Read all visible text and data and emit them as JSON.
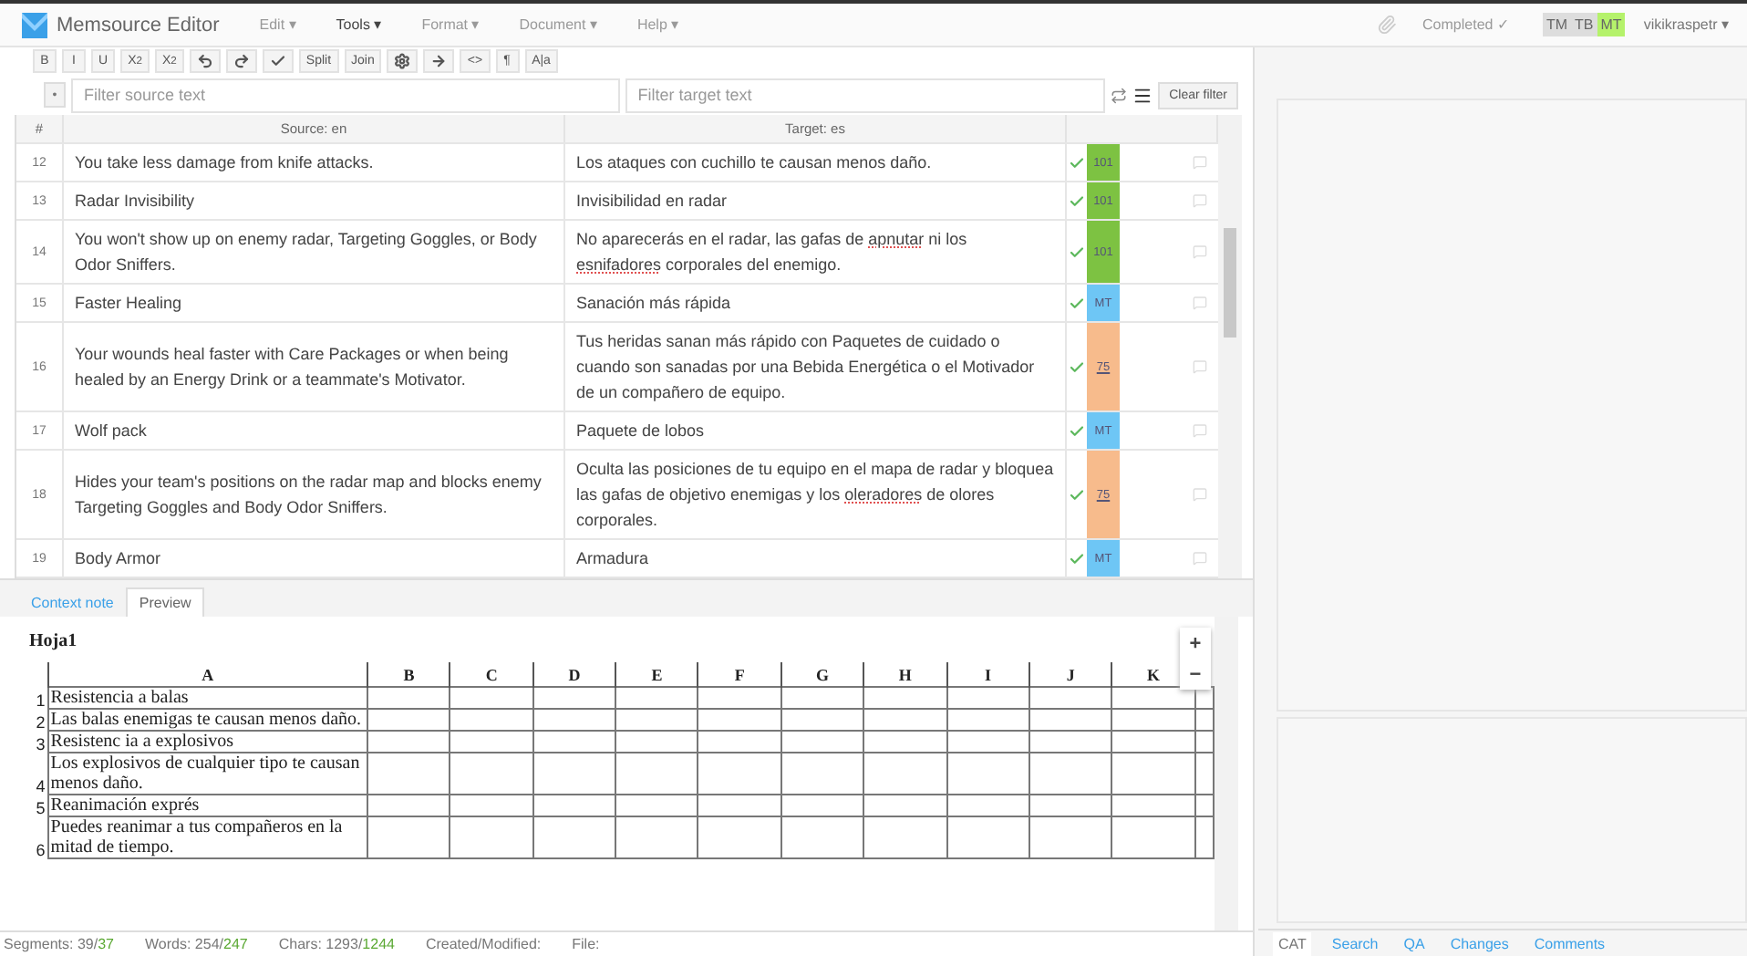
{
  "app": {
    "title": "Memsource Editor"
  },
  "menu": [
    {
      "label": "Edit ▾",
      "selected": false
    },
    {
      "label": "Tools ▾",
      "selected": true
    },
    {
      "label": "Format ▾",
      "selected": false
    },
    {
      "label": "Document ▾",
      "selected": false
    },
    {
      "label": "Help ▾",
      "selected": false
    }
  ],
  "status": {
    "label": "Completed ✓"
  },
  "sources": [
    {
      "label": "TM",
      "on": false
    },
    {
      "label": "TB",
      "on": false
    },
    {
      "label": "MT",
      "on": true
    }
  ],
  "user": "vikikraspetr ▾",
  "toolbar": [
    {
      "kind": "text",
      "label": "B"
    },
    {
      "kind": "text",
      "label": "I"
    },
    {
      "kind": "text",
      "label": "U"
    },
    {
      "kind": "sub",
      "label": "X",
      "mark": "2"
    },
    {
      "kind": "sup",
      "label": "X",
      "mark": "2"
    },
    {
      "kind": "undo"
    },
    {
      "kind": "redo"
    },
    {
      "kind": "check"
    },
    {
      "kind": "text",
      "label": "Split"
    },
    {
      "kind": "text",
      "label": "Join"
    },
    {
      "kind": "gear"
    },
    {
      "kind": "arrow"
    },
    {
      "kind": "text",
      "label": "<>"
    },
    {
      "kind": "text",
      "label": "¶"
    },
    {
      "kind": "text",
      "label": "A|a"
    }
  ],
  "filters": {
    "options": "•",
    "source_placeholder": "Filter source text",
    "target_placeholder": "Filter target text",
    "clear": "Clear filter"
  },
  "table": {
    "columns": [
      "#",
      "Source: en",
      "Target: es"
    ],
    "rows": [
      {
        "num": "12",
        "source": "You take less damage from knife attacks.",
        "target": [
          {
            "text": "Los ataques con cuchillo te causan menos daño.",
            "misspelled": false
          }
        ],
        "confirmed": true,
        "match": "101",
        "color": "#7dc242"
      },
      {
        "num": "13",
        "source": "Radar Invisibility",
        "target": [
          {
            "text": "Invisibilidad en radar",
            "misspelled": false
          }
        ],
        "confirmed": true,
        "match": "101",
        "color": "#7dc242"
      },
      {
        "num": "14",
        "source": "You won't show up on enemy radar, Targeting Goggles, or Body Odor Sniffers.",
        "target": [
          {
            "text": "No aparecerás en el radar, las gafas de ",
            "misspelled": false
          },
          {
            "text": "apnutar",
            "misspelled": true
          },
          {
            "text": " ni los ",
            "misspelled": false
          },
          {
            "text": "esnifadores",
            "misspelled": true
          },
          {
            "text": " corporales del enemigo.",
            "misspelled": false
          }
        ],
        "confirmed": true,
        "match": "101",
        "color": "#7dc242"
      },
      {
        "num": "15",
        "source": "Faster Healing",
        "target": [
          {
            "text": "Sanación más rápida",
            "misspelled": false
          }
        ],
        "confirmed": true,
        "match": "MT",
        "color": "#6ec6f5"
      },
      {
        "num": "16",
        "source": "Your wounds heal faster with Care Packages or when being healed by an Energy Drink or a teammate's Motivator.",
        "target": [
          {
            "text": "Tus heridas sanan más rápido con Paquetes de cuidado o cuando son sanadas por una Bebida Energética o el Motivador de un compañero de equipo.",
            "misspelled": false
          }
        ],
        "confirmed": true,
        "match": "75",
        "color": "#f7bb8c"
      },
      {
        "num": "17",
        "source": "Wolf pack",
        "target": [
          {
            "text": "Paquete de lobos",
            "misspelled": false
          }
        ],
        "confirmed": true,
        "match": "MT",
        "color": "#6ec6f5"
      },
      {
        "num": "18",
        "source": "Hides your team's positions on the radar map and blocks enemy Targeting Goggles and Body Odor Sniffers.",
        "target": [
          {
            "text": "Oculta las posiciones de tu equipo en el mapa de radar y bloquea las gafas de objetivo enemigas y los ",
            "misspelled": false
          },
          {
            "text": "oleradores",
            "misspelled": true
          },
          {
            "text": " de olores corporales.",
            "misspelled": false
          }
        ],
        "confirmed": true,
        "match": "75",
        "color": "#f7bb8c"
      },
      {
        "num": "19",
        "source": "Body Armor",
        "target": [
          {
            "text": "Armadura",
            "misspelled": false
          }
        ],
        "confirmed": true,
        "match": "MT",
        "color": "#6ec6f5"
      }
    ]
  },
  "bottom_tabs": [
    {
      "label": "Context note",
      "selected": false
    },
    {
      "label": "Preview",
      "selected": true
    }
  ],
  "preview": {
    "sheet": "Hoja1",
    "columns": [
      "A",
      "B",
      "C",
      "D",
      "E",
      "F",
      "G",
      "H",
      "I",
      "J",
      "K"
    ],
    "rows": [
      {
        "num": "1",
        "a": "Resistencia a balas"
      },
      {
        "num": "2",
        "a": "Las balas enemigas te causan menos daño."
      },
      {
        "num": "3",
        "a": "Resistenc ia a explosivos"
      },
      {
        "num": "4",
        "a": "Los explosivos de cualquier tipo te causan menos daño."
      },
      {
        "num": "5",
        "a": "Reanimación exprés"
      },
      {
        "num": "6",
        "a": "Puedes reanimar a tus compañeros en la mitad de tiempo."
      }
    ],
    "zoom_in": "+",
    "zoom_out": "−"
  },
  "status_bar": [
    {
      "label": "Segments:",
      "a": "39/",
      "b": "37"
    },
    {
      "label": "Words:",
      "a": "254/",
      "b": "247"
    },
    {
      "label": "Chars:",
      "a": "1293/",
      "b": "1244"
    },
    {
      "label": "Created/Modified:"
    },
    {
      "label": "File:"
    }
  ],
  "side_tabs": [
    {
      "label": "CAT",
      "selected": true
    },
    {
      "label": "Search",
      "selected": false
    },
    {
      "label": "QA",
      "selected": false
    },
    {
      "label": "Changes",
      "selected": false
    },
    {
      "label": "Comments",
      "selected": false
    }
  ]
}
